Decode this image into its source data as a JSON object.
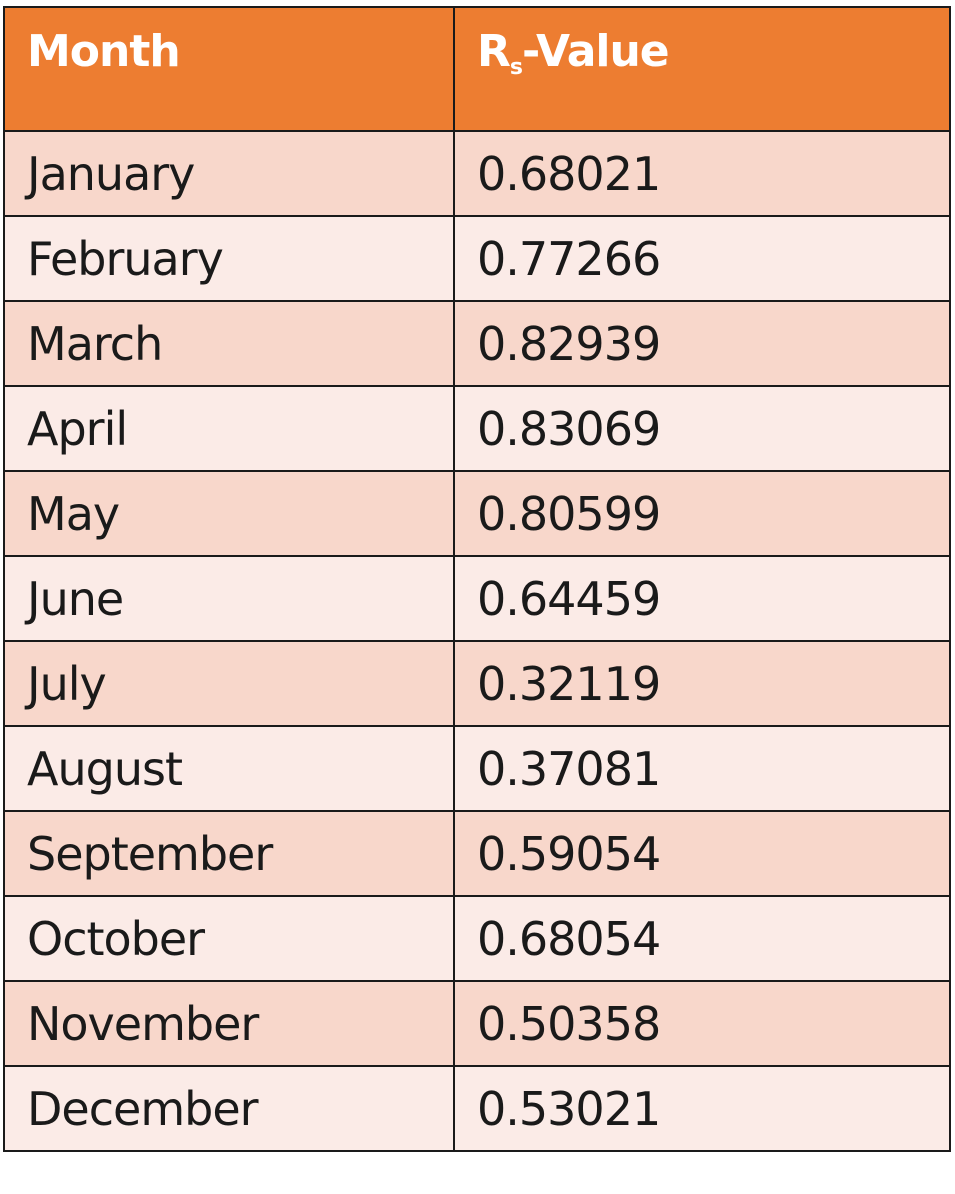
{
  "table": {
    "headers": {
      "month": "Month",
      "value_main": "R",
      "value_sub": "s",
      "value_suffix": "-Value"
    },
    "rows": [
      {
        "month": "January",
        "value": "0.68021"
      },
      {
        "month": "February",
        "value": "0.77266"
      },
      {
        "month": "March",
        "value": "0.82939"
      },
      {
        "month": "April",
        "value": "0.83069"
      },
      {
        "month": "May",
        "value": "0.80599"
      },
      {
        "month": "June",
        "value": "0.64459"
      },
      {
        "month": "July",
        "value": "0.32119"
      },
      {
        "month": "August",
        "value": "0.37081"
      },
      {
        "month": "September",
        "value": "0.59054"
      },
      {
        "month": "October",
        "value": "0.68054"
      },
      {
        "month": "November",
        "value": "0.50358"
      },
      {
        "month": "December",
        "value": "0.53021"
      }
    ]
  },
  "colors": {
    "header_bg": "#ed7d31",
    "row_dark": "#f8d7cb",
    "row_light": "#fbebe7"
  }
}
